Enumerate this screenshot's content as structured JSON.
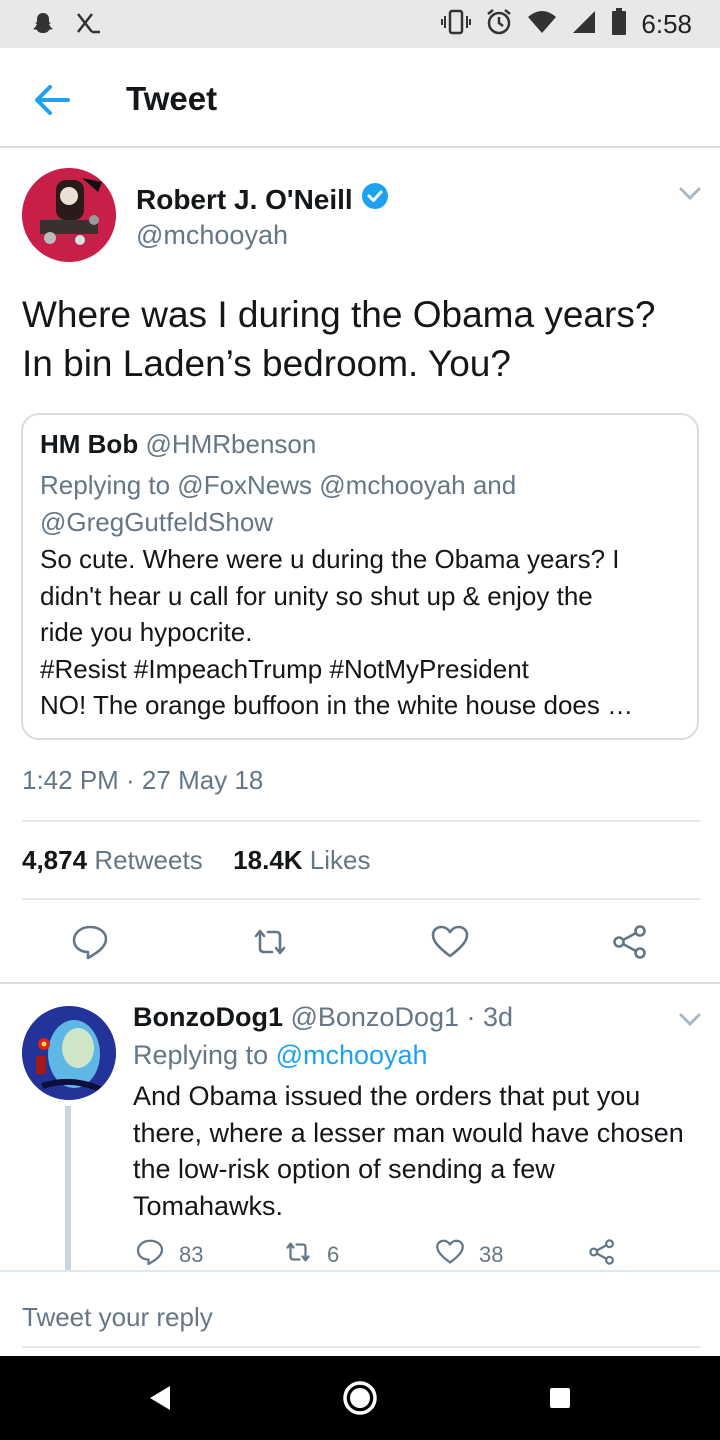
{
  "status_bar": {
    "time": "6:58"
  },
  "app_bar": {
    "title": "Tweet"
  },
  "tweet": {
    "author_name": "Robert J. O'Neill",
    "author_handle": "@mchooyah",
    "text_lines": [
      "Where was I during the Obama years?",
      "In bin Laden’s bedroom. You?"
    ],
    "quote": {
      "name": "HM Bob",
      "handle": "@HMRbenson",
      "replying_lines": [
        "Replying to @FoxNews @mchooyah and",
        "@GregGutfeldShow"
      ],
      "text_lines": [
        "So cute. Where were u during the Obama years? I",
        "didn't hear u call for unity so shut up & enjoy the",
        "ride you hypocrite.",
        "#Resist #ImpeachTrump #NotMyPresident",
        "NO! The orange buffoon in the white house does …"
      ]
    },
    "timestamp": "1:42 PM · 27 May 18",
    "retweets_count": "4,874",
    "retweets_label": "Retweets",
    "likes_count": "18.4K",
    "likes_label": "Likes"
  },
  "reply": {
    "name": "BonzoDog1",
    "meta": " @BonzoDog1 · 3d",
    "replying_prefix": "Replying to ",
    "replying_mention": "@mchooyah",
    "text_lines": [
      "And Obama issued the orders that put you",
      "there, where a lesser man would have chosen",
      "the low-risk option of sending a few",
      "Tomahawks."
    ],
    "reply_count": "83",
    "retweet_count": "6",
    "like_count": "38"
  },
  "reply_box": {
    "placeholder": "Tweet your reply"
  },
  "colors": {
    "accent": "#1da1f2",
    "secondary_text": "#657786",
    "verified": "#1da1f2"
  }
}
